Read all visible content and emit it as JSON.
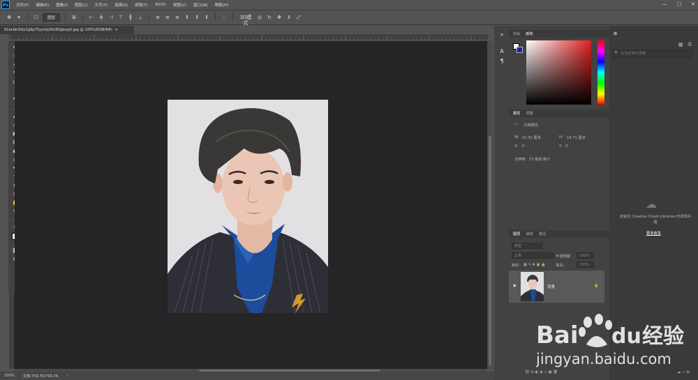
{
  "app": {
    "logo": "Ps"
  },
  "menu": [
    "文件(F)",
    "编辑(E)",
    "图像(I)",
    "图层(L)",
    "文字(Y)",
    "选择(S)",
    "滤镜(T)",
    "3D(D)",
    "视图(V)",
    "窗口(W)",
    "帮助(H)"
  ],
  "window_controls": {
    "minimize": "—",
    "maximize": "□",
    "close": "✕"
  },
  "options_bar": {
    "auto_select_target": "图层"
  },
  "document": {
    "tab_title": "61ecbb3dly1g9p75yznkj20c80gbwg5.jpg @ 100%(RGB/8#)",
    "close": "×"
  },
  "status": {
    "zoom": "100%",
    "doc_size": "文档:759.7K/759.7K"
  },
  "panels": {
    "swatches_tab": "色板",
    "color_tab": "颜色",
    "properties_tab": "属性",
    "adjustments_tab": "调整",
    "doc_props_title": "文档属性",
    "width_label": "W:",
    "width_value": "15.32 厘米",
    "height_label": "H:",
    "height_value": "19.71 厘米",
    "x_label": "X:",
    "x_value": "0",
    "y_label": "Y:",
    "y_value": "0",
    "resolution": "分辨率：72 像素/英寸",
    "layers_tab": "图层",
    "channels_tab": "通道",
    "paths_tab": "路径",
    "kind_filter": "类型",
    "blend_mode": "正常",
    "opacity_label": "不透明度：",
    "opacity_value": "100%",
    "lock_label": "锁定：",
    "fill_label": "填充：",
    "fill_value": "100%",
    "layer_name": "背景"
  },
  "libraries": {
    "tab": "库",
    "search_placeholder": "在当前库中搜索",
    "error": "初始化 Creative Cloud Libraries 时出现问题",
    "more_info": "更多信息"
  },
  "colors": {
    "fg": "#ffffff",
    "bg": "#1a1fa3",
    "canvas": "#262427",
    "ui": "#535353",
    "panel": "#424242"
  },
  "watermark": {
    "brand_latin_a": "Bai",
    "brand_latin_b": "du",
    "brand_cn": "经验",
    "url": "jingyan.baidu.com"
  }
}
